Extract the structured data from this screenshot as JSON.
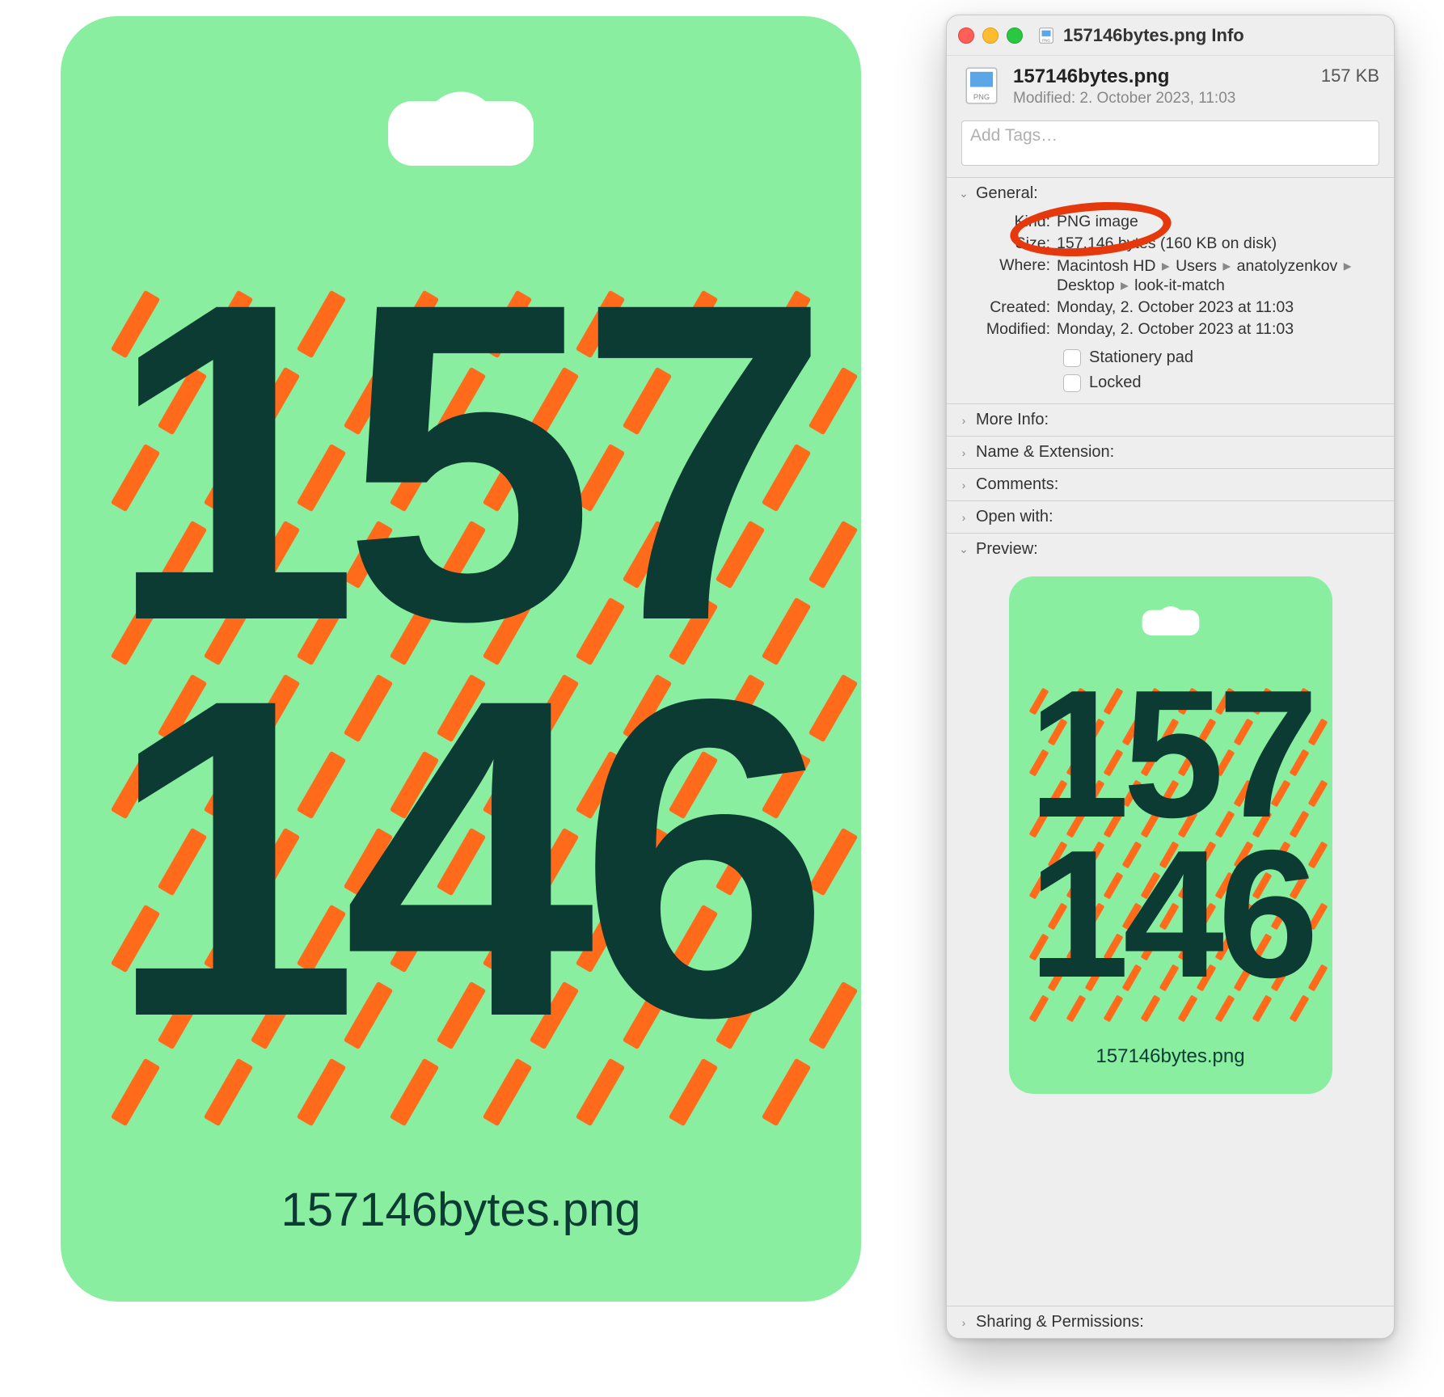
{
  "card": {
    "top_number": "157",
    "bottom_number": "146",
    "caption": "157146bytes.png"
  },
  "inspector": {
    "window_title": "157146bytes.png Info",
    "file_name": "157146bytes.png",
    "file_size_short": "157 KB",
    "modified_short": "Modified: 2. October 2023, 11:03",
    "tags_placeholder": "Add Tags…",
    "sections": {
      "general": {
        "title": "General:",
        "kind_label": "Kind:",
        "kind_value": "PNG image",
        "size_label": "Size:",
        "size_value": "157.146 bytes (160 KB on disk)",
        "where_label": "Where:",
        "where_parts": [
          "Macintosh HD",
          "Users",
          "anatolyzenkov",
          "Desktop",
          "look-it-match"
        ],
        "created_label": "Created:",
        "created_value": "Monday, 2. October 2023 at 11:03",
        "modified_label": "Modified:",
        "modified_value": "Monday, 2. October 2023 at 11:03",
        "stationery_label": "Stationery pad",
        "locked_label": "Locked"
      },
      "more_info": "More Info:",
      "name_extension": "Name & Extension:",
      "comments": "Comments:",
      "open_with": "Open with:",
      "preview": "Preview:",
      "sharing": "Sharing & Permissions:"
    }
  },
  "preview_card": {
    "top_number": "157",
    "bottom_number": "146",
    "caption": "157146bytes.png"
  }
}
